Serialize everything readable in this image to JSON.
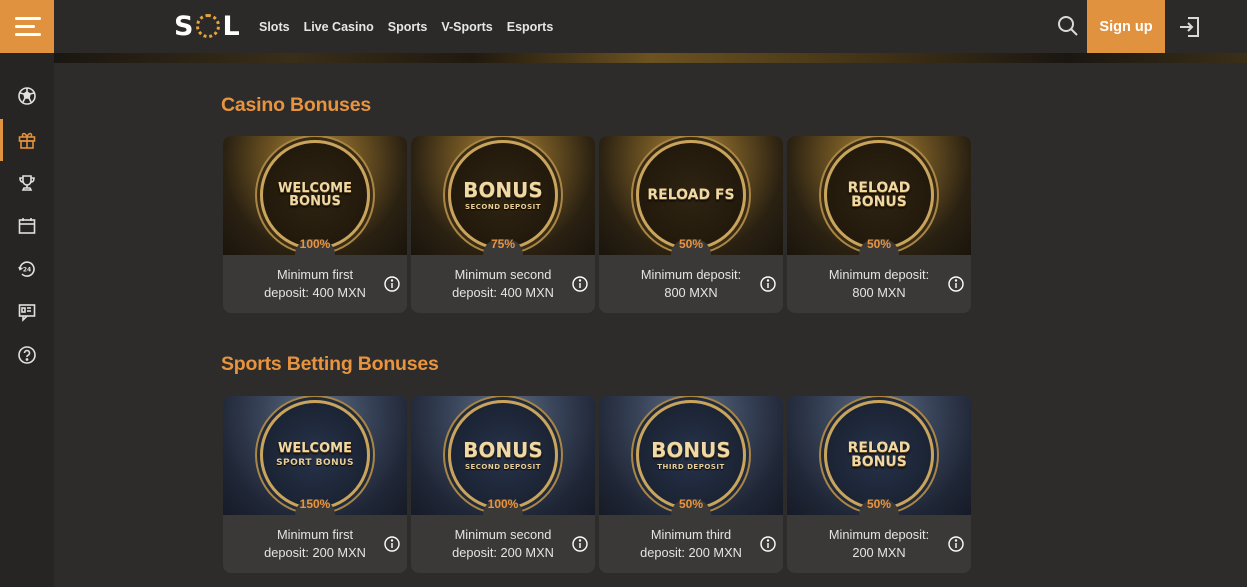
{
  "header": {
    "logo": "SOL",
    "nav": [
      "Slots",
      "Live Casino",
      "Sports",
      "V-Sports",
      "Esports"
    ],
    "signup_label": "Sign up"
  },
  "brand_color": "#e1923e",
  "sidebar": {
    "items": [
      {
        "icon": "soccer-ball-icon"
      },
      {
        "icon": "gift-icon",
        "active": true
      },
      {
        "icon": "trophy-icon"
      },
      {
        "icon": "calendar-icon"
      },
      {
        "icon": "support-24-icon"
      },
      {
        "icon": "chat-icon"
      },
      {
        "icon": "help-icon"
      }
    ]
  },
  "casino": {
    "title": "Casino Bonuses",
    "cards": [
      {
        "badge_main": "WELCOME BONUS",
        "badge_sub": "",
        "percent": "100%",
        "line1": "Minimum first",
        "line2": "deposit: 400 MXN"
      },
      {
        "badge_main": "BONUS",
        "badge_sub": "SECOND DEPOSIT",
        "percent": "75%",
        "line1": "Minimum second",
        "line2": "deposit: 400 MXN"
      },
      {
        "badge_main": "RELOAD FS",
        "badge_sub": "",
        "percent": "50%",
        "line1": "Minimum deposit:",
        "line2": "800 MXN"
      },
      {
        "badge_main": "RELOAD BONUS",
        "badge_sub": "",
        "percent": "50%",
        "line1": "Minimum deposit:",
        "line2": "800 MXN"
      }
    ]
  },
  "sports": {
    "title": "Sports Betting Bonuses",
    "cards": [
      {
        "badge_main": "WELCOME",
        "badge_sub": "SPORT BONUS",
        "percent": "150%",
        "line1": "Minimum first",
        "line2": "deposit: 200 MXN"
      },
      {
        "badge_main": "BONUS",
        "badge_sub": "SECOND DEPOSIT",
        "percent": "100%",
        "line1": "Minimum second",
        "line2": "deposit: 200 MXN"
      },
      {
        "badge_main": "BONUS",
        "badge_sub": "THIRD DEPOSIT",
        "percent": "50%",
        "line1": "Minimum third",
        "line2": "deposit: 200 MXN"
      },
      {
        "badge_main": "RELOAD BONUS",
        "badge_sub": "",
        "percent": "50%",
        "line1": "Minimum deposit:",
        "line2": "200 MXN"
      }
    ]
  }
}
